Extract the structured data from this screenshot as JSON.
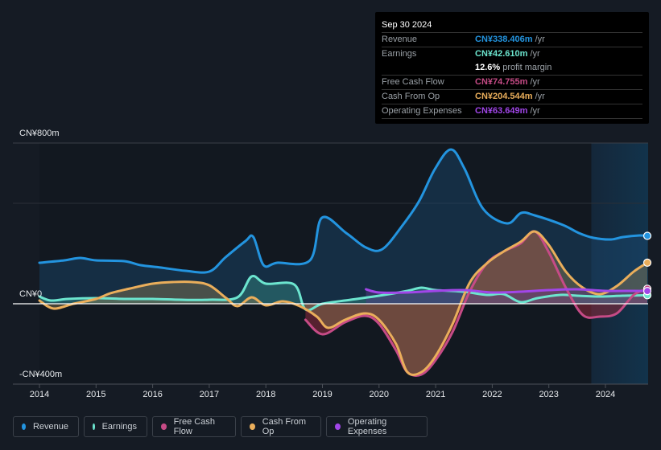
{
  "tooltip": {
    "date": "Sep 30 2024",
    "rows": [
      {
        "label": "Revenue",
        "value": "CN¥338.406m",
        "unit": "/yr",
        "color": "#2394df"
      },
      {
        "label": "Earnings",
        "value": "CN¥42.610m",
        "unit": "/yr",
        "color": "#6ce5cf"
      },
      {
        "label": "Free Cash Flow",
        "value": "CN¥74.755m",
        "unit": "/yr",
        "color": "#c64b86"
      },
      {
        "label": "Cash From Op",
        "value": "CN¥204.544m",
        "unit": "/yr",
        "color": "#eaae5b"
      },
      {
        "label": "Operating Expenses",
        "value": "CN¥63.649m",
        "unit": "/yr",
        "color": "#a146e8"
      }
    ],
    "profit_margin_value": "12.6%",
    "profit_margin_text": "profit margin"
  },
  "legend": [
    {
      "label": "Revenue",
      "color": "#2394df"
    },
    {
      "label": "Earnings",
      "color": "#6ce5cf"
    },
    {
      "label": "Free Cash Flow",
      "color": "#c64b86"
    },
    {
      "label": "Cash From Op",
      "color": "#eaae5b"
    },
    {
      "label": "Operating Expenses",
      "color": "#a146e8"
    }
  ],
  "chart_data": {
    "type": "area",
    "title": "",
    "xlabel": "",
    "ylabel": "",
    "currency": "CN¥",
    "ylim": [
      -400,
      800
    ],
    "ytick_labels": [
      "CN¥800m",
      "CN¥0",
      "-CN¥400m"
    ],
    "yticks": [
      800,
      0,
      -400
    ],
    "xlim": [
      2013.53,
      2024.75
    ],
    "xticks": [
      2014,
      2015,
      2016,
      2017,
      2018,
      2019,
      2020,
      2021,
      2022,
      2023,
      2024
    ],
    "xtick_labels": [
      "2014",
      "2015",
      "2016",
      "2017",
      "2018",
      "2019",
      "2020",
      "2021",
      "2022",
      "2023",
      "2024"
    ],
    "forecast_shade_start": 2023.75,
    "grid": true,
    "legend_position": "bottom",
    "series": [
      {
        "name": "Revenue",
        "color": "#2394df",
        "x": [
          2014.0,
          2014.44,
          2014.72,
          2015.0,
          2015.5,
          2015.79,
          2016.15,
          2016.58,
          2017.0,
          2017.29,
          2017.64,
          2017.78,
          2017.96,
          2018.2,
          2018.78,
          2018.99,
          2019.42,
          2019.77,
          2020.06,
          2020.42,
          2020.71,
          2020.99,
          2021.27,
          2021.51,
          2021.84,
          2022.26,
          2022.51,
          2022.75,
          2023.25,
          2023.53,
          2023.79,
          2024.1,
          2024.31,
          2024.6,
          2024.74
        ],
        "values": [
          204,
          216,
          228,
          216,
          212,
          192,
          180,
          164,
          160,
          232,
          312,
          332,
          192,
          204,
          216,
          428,
          352,
          280,
          272,
          392,
          512,
          672,
          768,
          672,
          472,
          400,
          452,
          440,
          392,
          352,
          328,
          320,
          332,
          340,
          338
        ]
      },
      {
        "name": "Earnings",
        "color": "#6ce5cf",
        "x": [
          2014.0,
          2014.2,
          2014.5,
          2015.0,
          2015.5,
          2016.0,
          2016.5,
          2017.0,
          2017.5,
          2017.75,
          2018.0,
          2018.5,
          2018.7,
          2019.0,
          2019.5,
          2020.0,
          2020.5,
          2020.75,
          2021.0,
          2021.5,
          2021.9,
          2022.2,
          2022.5,
          2022.8,
          2023.2,
          2023.5,
          2023.9,
          2024.3,
          2024.74
        ],
        "values": [
          36,
          16,
          24,
          28,
          24,
          24,
          20,
          20,
          32,
          136,
          100,
          96,
          -28,
          0,
          20,
          40,
          64,
          80,
          68,
          60,
          44,
          48,
          8,
          28,
          44,
          40,
          36,
          40,
          42.6
        ]
      },
      {
        "name": "Free Cash Flow",
        "color": "#c64b86",
        "x": [
          2018.7,
          2019.0,
          2019.4,
          2019.75,
          2020.0,
          2020.3,
          2020.5,
          2020.75,
          2021.0,
          2021.3,
          2021.6,
          2021.9,
          2022.2,
          2022.5,
          2022.75,
          2023.0,
          2023.3,
          2023.6,
          2023.9,
          2024.2,
          2024.5,
          2024.74
        ],
        "values": [
          -80,
          -152,
          -92,
          -60,
          -100,
          -232,
          -340,
          -352,
          -280,
          -140,
          60,
          200,
          260,
          300,
          360,
          256,
          80,
          -56,
          -64,
          -48,
          44,
          74.8
        ]
      },
      {
        "name": "Cash From Op",
        "color": "#eaae5b",
        "x": [
          2014.0,
          2014.25,
          2014.6,
          2015.0,
          2015.25,
          2015.6,
          2016.0,
          2016.35,
          2016.7,
          2017.0,
          2017.3,
          2017.5,
          2017.75,
          2018.0,
          2018.3,
          2018.6,
          2018.9,
          2019.1,
          2019.4,
          2019.75,
          2020.0,
          2020.3,
          2020.5,
          2020.75,
          2021.0,
          2021.3,
          2021.6,
          2021.9,
          2022.2,
          2022.5,
          2022.75,
          2023.0,
          2023.3,
          2023.6,
          2023.9,
          2024.2,
          2024.5,
          2024.74
        ],
        "values": [
          16,
          -24,
          0,
          24,
          52,
          76,
          100,
          108,
          108,
          92,
          28,
          -12,
          32,
          -8,
          12,
          -12,
          -64,
          -120,
          -80,
          -48,
          -80,
          -200,
          -340,
          -340,
          -260,
          -100,
          104,
          200,
          260,
          308,
          360,
          292,
          160,
          80,
          48,
          88,
          160,
          204.5
        ]
      },
      {
        "name": "Operating Expenses",
        "color": "#a146e8",
        "x": [
          2019.77,
          2020.0,
          2020.5,
          2021.0,
          2021.5,
          2022.0,
          2022.5,
          2023.0,
          2023.5,
          2024.0,
          2024.5,
          2024.74
        ],
        "values": [
          72,
          56,
          56,
          64,
          68,
          56,
          60,
          68,
          72,
          64,
          64,
          63.6
        ]
      }
    ]
  }
}
